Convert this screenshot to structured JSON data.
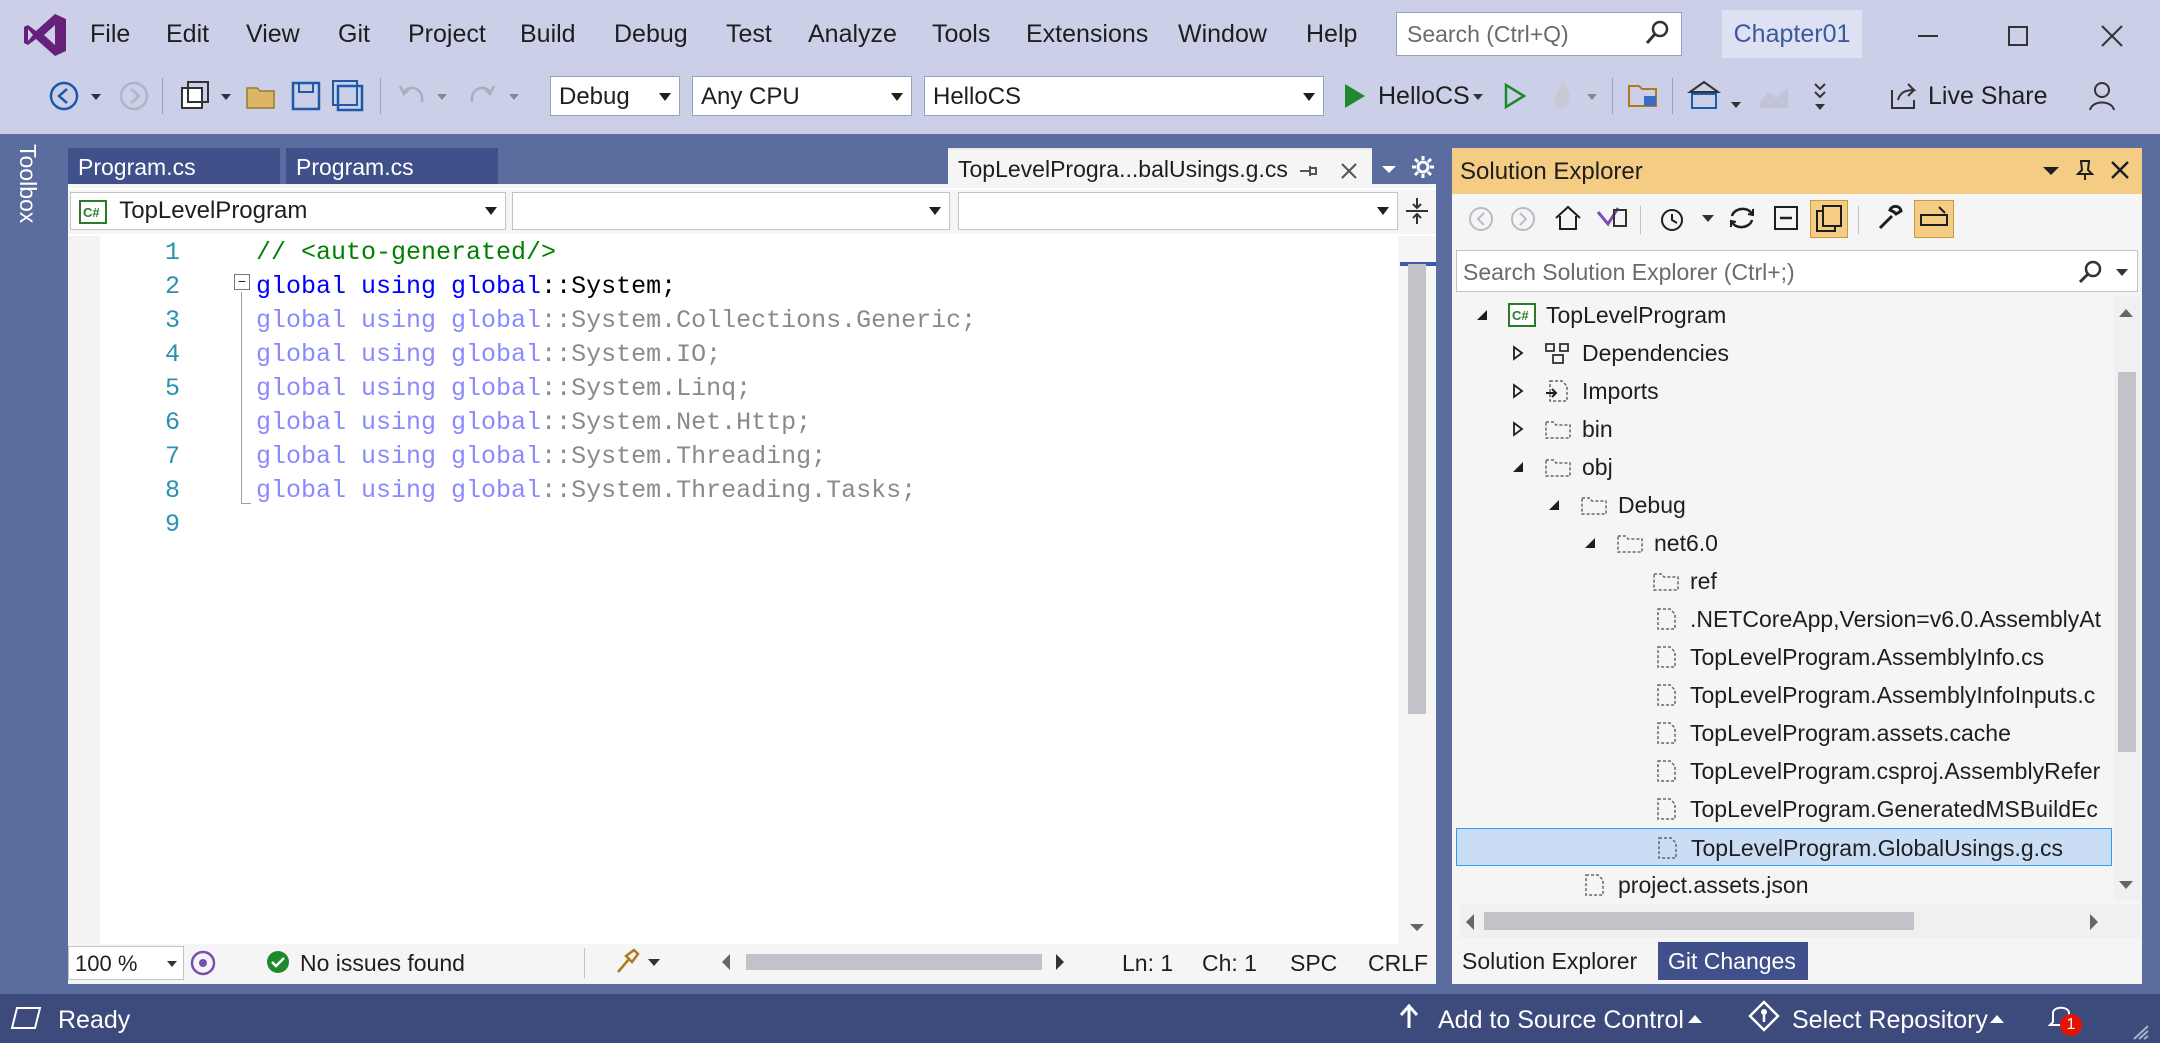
{
  "menu": [
    "File",
    "Edit",
    "View",
    "Git",
    "Project",
    "Build",
    "Debug",
    "Test",
    "Analyze",
    "Tools",
    "Extensions",
    "Window",
    "Help"
  ],
  "search": {
    "placeholder": "Search (Ctrl+Q)"
  },
  "solution_name": "Chapter01",
  "toolbar": {
    "configuration": "Debug",
    "platform": "Any CPU",
    "startup_project": "HelloCS",
    "run_label": "HelloCS",
    "live_share": "Live Share"
  },
  "toolbox_label": "Toolbox",
  "editor": {
    "tabs": [
      {
        "label": "Program.cs"
      },
      {
        "label": "Program.cs"
      },
      {
        "label": "TopLevelProgra...balUsings.g.cs"
      }
    ],
    "nav": {
      "project": "TopLevelProgram",
      "type": "",
      "member": ""
    },
    "line_numbers": [
      "1",
      "2",
      "3",
      "4",
      "5",
      "6",
      "7",
      "8",
      "9"
    ],
    "code_lines": [
      "// <auto-generated/>",
      "global using global::System;",
      "global using global::System.Collections.Generic;",
      "global using global::System.IO;",
      "global using global::System.Linq;",
      "global using global::System.Net.Http;",
      "global using global::System.Threading;",
      "global using global::System.Threading.Tasks;",
      ""
    ],
    "status": {
      "zoom": "100 %",
      "issues": "No issues found",
      "line": "Ln: 1",
      "char": "Ch: 1",
      "whitespace": "SPC",
      "line_ending": "CRLF"
    }
  },
  "solution_explorer": {
    "title": "Solution Explorer",
    "search_placeholder": "Search Solution Explorer (Ctrl+;)",
    "tree": [
      {
        "label": "TopLevelProgram",
        "level": 0,
        "expander": "open",
        "icon": "csharp-project-icon"
      },
      {
        "label": "Dependencies",
        "level": 1,
        "expander": "closed",
        "icon": "dependencies-icon"
      },
      {
        "label": "Imports",
        "level": 1,
        "expander": "closed",
        "icon": "imports-icon"
      },
      {
        "label": "bin",
        "level": 1,
        "expander": "closed",
        "icon": "folder-icon"
      },
      {
        "label": "obj",
        "level": 1,
        "expander": "open",
        "icon": "folder-icon"
      },
      {
        "label": "Debug",
        "level": 2,
        "expander": "open",
        "icon": "folder-icon"
      },
      {
        "label": "net6.0",
        "level": 3,
        "expander": "open",
        "icon": "folder-icon"
      },
      {
        "label": "ref",
        "level": 4,
        "expander": "none",
        "icon": "folder-icon"
      },
      {
        "label": ".NETCoreApp,Version=v6.0.AssemblyAt",
        "level": 4,
        "expander": "none",
        "icon": "file-icon"
      },
      {
        "label": "TopLevelProgram.AssemblyInfo.cs",
        "level": 4,
        "expander": "none",
        "icon": "file-icon"
      },
      {
        "label": "TopLevelProgram.AssemblyInfoInputs.c",
        "level": 4,
        "expander": "none",
        "icon": "file-icon"
      },
      {
        "label": "TopLevelProgram.assets.cache",
        "level": 4,
        "expander": "none",
        "icon": "file-icon"
      },
      {
        "label": "TopLevelProgram.csproj.AssemblyRefer",
        "level": 4,
        "expander": "none",
        "icon": "file-icon"
      },
      {
        "label": "TopLevelProgram.GeneratedMSBuildEc",
        "level": 4,
        "expander": "none",
        "icon": "file-icon"
      },
      {
        "label": "TopLevelProgram.GlobalUsings.g.cs",
        "level": 4,
        "expander": "none",
        "icon": "file-icon",
        "selected": true
      },
      {
        "label": "project.assets.json",
        "level": 2,
        "expander": "none",
        "icon": "file-icon"
      }
    ],
    "bottom_tabs": [
      "Solution Explorer",
      "Git Changes"
    ]
  },
  "statusbar": {
    "state": "Ready",
    "source_control": "Add to Source Control",
    "repository": "Select Repository",
    "notifications": "1"
  },
  "colors": {
    "accent": "#68217a",
    "statusbar": "#3d4a7c",
    "selected_tab": "#f5cc84"
  }
}
